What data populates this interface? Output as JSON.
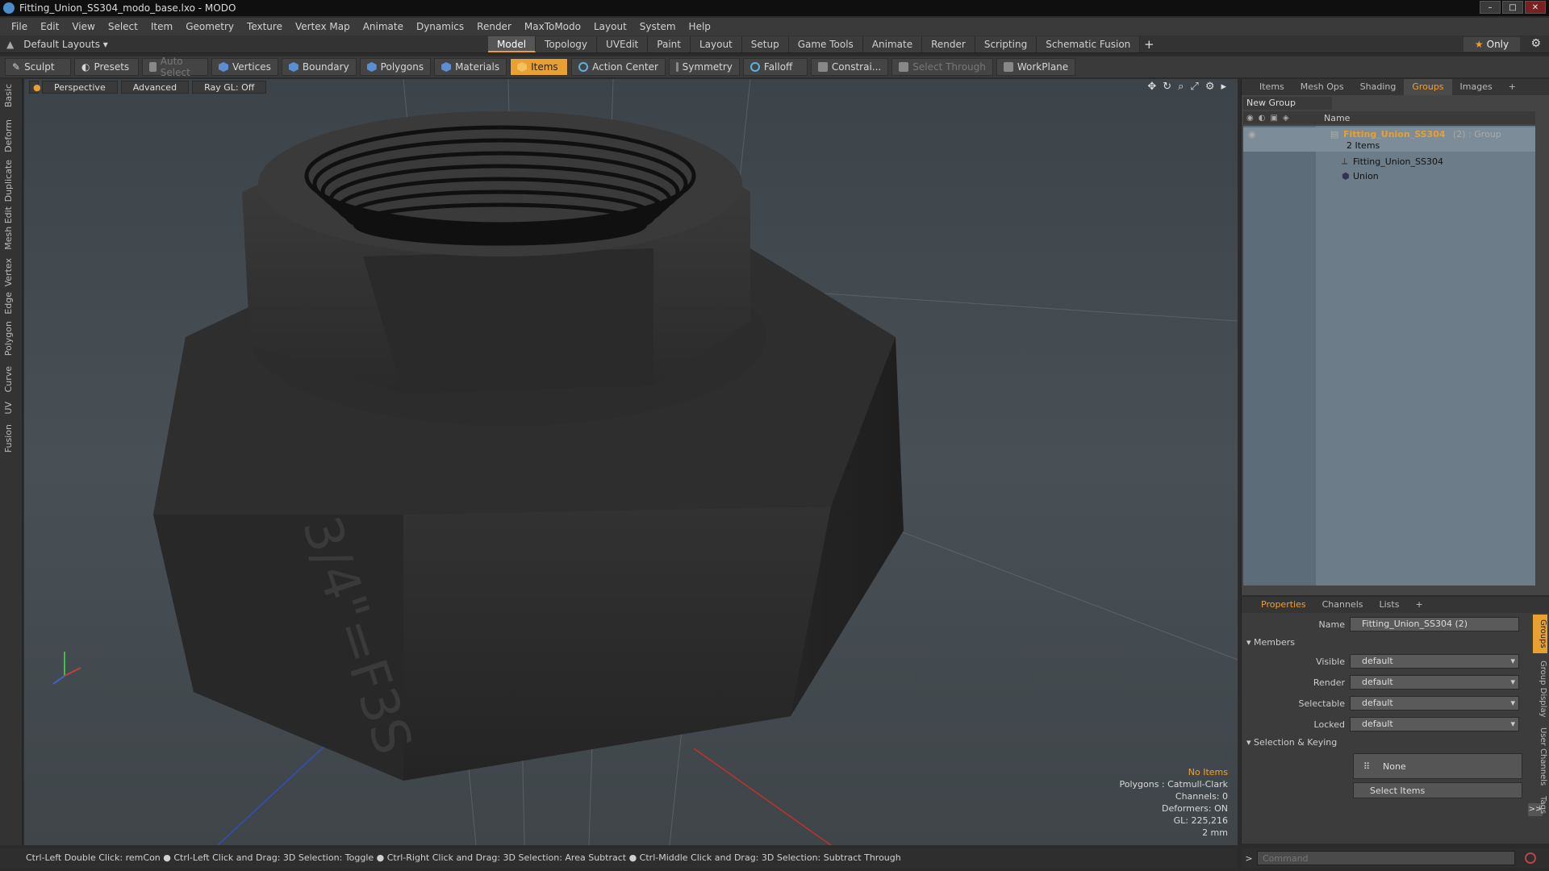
{
  "window": {
    "title": "Fitting_Union_SS304_modo_base.lxo - MODO",
    "controls": [
      "–",
      "□",
      "✕"
    ]
  },
  "menu": [
    "File",
    "Edit",
    "View",
    "Select",
    "Item",
    "Geometry",
    "Texture",
    "Vertex Map",
    "Animate",
    "Dynamics",
    "Render",
    "MaxToModo",
    "Layout",
    "System",
    "Help"
  ],
  "layout": {
    "selector": "Default Layouts",
    "tabs": [
      "Model",
      "Topology",
      "UVEdit",
      "Paint",
      "Layout",
      "Setup",
      "Game Tools",
      "Animate",
      "Render",
      "Scripting",
      "Schematic Fusion"
    ],
    "active_tab": "Model",
    "only_label": "Only"
  },
  "toolbar": {
    "sculpt": "Sculpt",
    "presets": "Presets",
    "auto_select": "Auto Select",
    "vertices": "Vertices",
    "boundary": "Boundary",
    "polygons": "Polygons",
    "materials": "Materials",
    "items": "Items",
    "action_center": "Action Center",
    "symmetry": "Symmetry",
    "falloff": "Falloff",
    "constraints": "Constrai...",
    "select_through": "Select Through",
    "workplane": "WorkPlane"
  },
  "left_tabs": [
    "Basic",
    "Deform",
    "Duplicate",
    "Mesh Edit",
    "Vertex",
    "Edge",
    "Polygon",
    "Curve",
    "UV",
    "Fusion"
  ],
  "viewport": {
    "view": "Perspective",
    "mode": "Advanced",
    "raygl": "Ray GL: Off",
    "info": {
      "no_items": "No Items",
      "polygons": "Polygons : Catmull-Clark",
      "channels": "Channels: 0",
      "deformers": "Deformers: ON",
      "gl": "GL: 225,216",
      "scale": "2 mm"
    },
    "emboss": "3/4\"=F3S"
  },
  "status": "Ctrl-Left Double Click: remCon ● Ctrl-Left Click and Drag: 3D Selection: Toggle ● Ctrl-Right Click and Drag: 3D Selection: Area Subtract ● Ctrl-Middle Click and Drag: 3D Selection: Subtract Through",
  "panel": {
    "tabs": [
      "Items",
      "Mesh Ops",
      "Shading",
      "Groups",
      "Images"
    ],
    "active_tab": "Groups",
    "new_group": "New Group",
    "name_col": "Name",
    "tree": {
      "group_name": "Fitting_Union_SS304",
      "group_suffix": "(2) : Group",
      "items_count": "2 Items",
      "child1": "Fitting_Union_SS304",
      "child2": "Union"
    }
  },
  "properties": {
    "tabs": [
      "Properties",
      "Channels",
      "Lists"
    ],
    "active_tab": "Properties",
    "name_label": "Name",
    "name_value": "Fitting_Union_SS304 (2)",
    "members": "Members",
    "visible_label": "Visible",
    "render_label": "Render",
    "selectable_label": "Selectable",
    "locked_label": "Locked",
    "default_value": "default",
    "sel_keying": "Selection & Keying",
    "none": "None",
    "select_items": "Select Items",
    "side_tabs": [
      "Groups",
      "Group Display",
      "User Channels",
      "Tags"
    ]
  },
  "command": {
    "placeholder": "Command"
  },
  "colors": {
    "accent": "#e8a030",
    "tree_bg": "#6c7c88"
  }
}
